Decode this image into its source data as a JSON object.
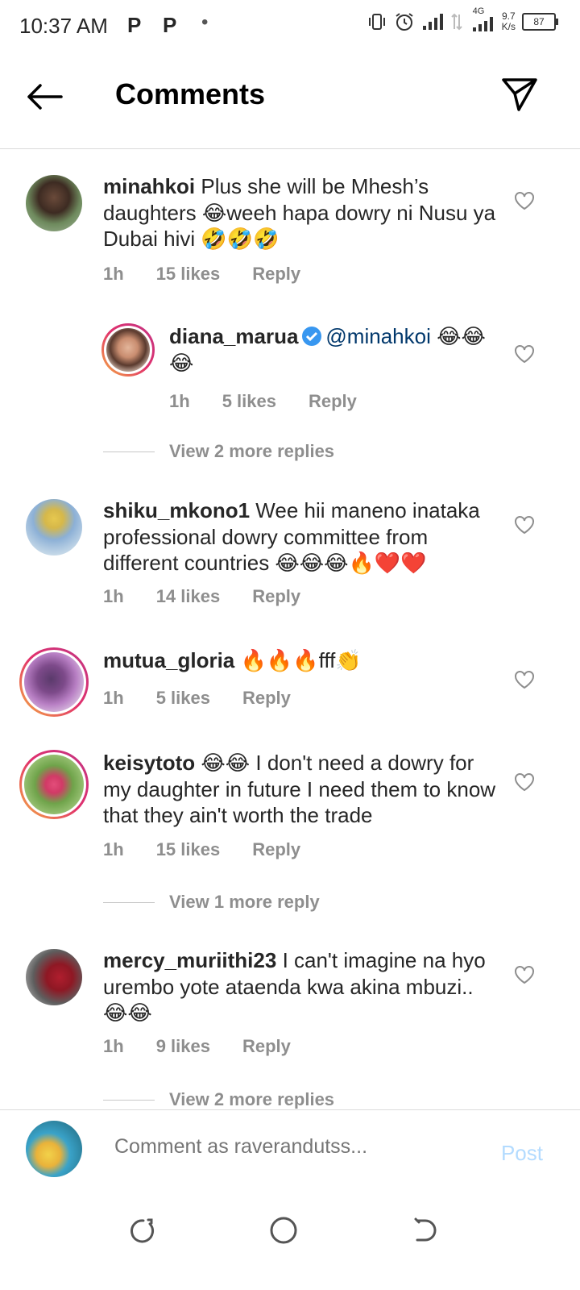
{
  "status_bar": {
    "time": "10:37 AM",
    "notif_icons": [
      "P",
      "P"
    ],
    "network_label": "4G",
    "net_rate_top": "9.7",
    "net_rate_bottom": "K/s",
    "battery": "87"
  },
  "header": {
    "title": "Comments"
  },
  "comments": [
    {
      "username": "minahkoi",
      "text": "Plus she will be Mhesh’s daughters 😂weeh hapa dowry ni Nusu ya Dubai hivi 🤣🤣🤣",
      "time": "1h",
      "likes": "15 likes",
      "reply": "Reply"
    },
    {
      "username": "diana_marua",
      "verified": true,
      "mention": "@minahkoi",
      "text": "😂😂😂",
      "time": "1h",
      "likes": "5 likes",
      "reply": "Reply"
    },
    {
      "username": "shiku_mkono1",
      "text": "Wee hii maneno  inataka professional dowry committee from different countries 😂😂😂🔥❤️❤️",
      "time": "1h",
      "likes": "14 likes",
      "reply": "Reply"
    },
    {
      "username": "mutua_gloria",
      "text": "🔥🔥🔥fff👏",
      "time": "1h",
      "likes": "5 likes",
      "reply": "Reply"
    },
    {
      "username": "keisytoto",
      "text": "😂😂 I don't need a dowry for my daughter in future I need them to know that they ain't worth the trade",
      "time": "1h",
      "likes": "15 likes",
      "reply": "Reply"
    },
    {
      "username": "mercy_muriithi23",
      "text": "I can't imagine na hyo urembo yote ataenda kwa akina mbuzi.. 😂😂",
      "time": "1h",
      "likes": "9 likes",
      "reply": "Reply"
    }
  ],
  "view_replies": [
    "View 2 more replies",
    "View 1 more reply",
    "View 2 more replies"
  ],
  "composer": {
    "placeholder": "Comment as raverandutss...",
    "post_label": "Post"
  },
  "colors": {
    "accent_link": "#00376b",
    "post_disabled": "#b3dbff",
    "verified": "#3897f0"
  },
  "icons": [
    "back-arrow-icon",
    "direct-send-icon",
    "heart-icon",
    "verified-badge-icon",
    "nav-recents-icon",
    "nav-home-icon",
    "nav-back-icon"
  ]
}
